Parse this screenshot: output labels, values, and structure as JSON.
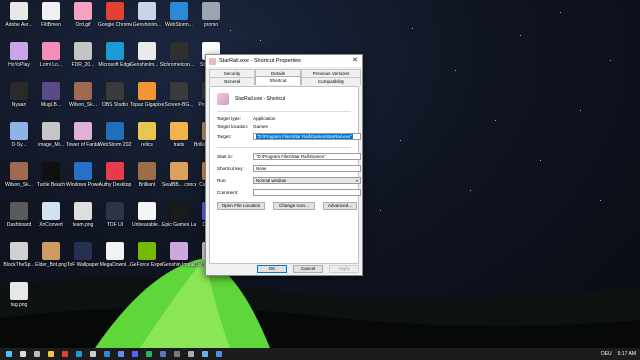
{
  "desktop": {
    "icons": [
      {
        "label": "Adobe Aer...",
        "color": "#e8e8e8"
      },
      {
        "label": "FiltBmen",
        "color": "#f0f0f0"
      },
      {
        "label": "Ord.gif",
        "color": "#f4a2c0"
      },
      {
        "label": "Google Chrome",
        "color": "#e34133"
      },
      {
        "label": "GenshinIm...",
        "color": "#c9d4e6"
      },
      {
        "label": "WebStorm...",
        "color": "#2b89d6"
      },
      {
        "label": "promo",
        "color": "#9da3b0"
      },
      {
        "label": "HoYoPlay",
        "color": "#c8a6e8"
      },
      {
        "label": "Lomi Lo...",
        "color": "#f38fb7"
      },
      {
        "label": "FDR_20...",
        "color": "#c4c4c4"
      },
      {
        "label": "Microsoft Edge",
        "color": "#1a9bd7"
      },
      {
        "label": "GenshinIm... Shortcut",
        "color": "#eaeaea"
      },
      {
        "label": "chromeIcon...",
        "color": "#2f2f2f"
      },
      {
        "label": "StarRail...",
        "color": "#ffffff"
      },
      {
        "label": "Nyaan",
        "color": "#2a2a2a"
      },
      {
        "label": "MugLB...",
        "color": "#5b4a88"
      },
      {
        "label": "Wilson_Sk...",
        "color": "#a06a52"
      },
      {
        "label": "OBS Studio",
        "color": "#3a3a3a"
      },
      {
        "label": "Topaz Gigapixel AI",
        "color": "#f19632"
      },
      {
        "label": "Screen-BG...",
        "color": "#3b3b3b"
      },
      {
        "label": "ProfilePic...",
        "color": "#3c3c3c"
      },
      {
        "label": "D-Sy...",
        "color": "#8fb3e8"
      },
      {
        "label": "image_Mi...",
        "color": "#c6c6c6"
      },
      {
        "label": "Tower of Fantasy",
        "color": "#dfb1d8"
      },
      {
        "label": "WebStorm 2021.1",
        "color": "#1f6fbb"
      },
      {
        "label": "relics",
        "color": "#e9c64f"
      },
      {
        "label": "traits",
        "color": "#f2b34b"
      },
      {
        "label": "Brilliant... concept.png",
        "color": "#c29463"
      },
      {
        "label": "Wilson_Sk...",
        "color": "#a06a52"
      },
      {
        "label": "Turtle Beach",
        "color": "#101010"
      },
      {
        "label": "Windows PowerShell",
        "color": "#2770c5"
      },
      {
        "label": "Authy Desktop",
        "color": "#e83b4c"
      },
      {
        "label": "Brilliant",
        "color": "#9b6e47"
      },
      {
        "label": "SealBB... concept.png",
        "color": "#d9a15b"
      },
      {
        "label": "CarryAvt...",
        "color": "#d98b52"
      },
      {
        "label": "Dashboard",
        "color": "#5a5a5a"
      },
      {
        "label": "XnConvert",
        "color": "#cfe3f0"
      },
      {
        "label": "team.png",
        "color": "#dedede"
      },
      {
        "label": "TOF UI",
        "color": "#2e3346"
      },
      {
        "label": "Unbearable...",
        "color": "#f5f5f5"
      },
      {
        "label": "Epic Games Launcher",
        "color": "#1a1a1a"
      },
      {
        "label": "Discord",
        "color": "#5865f2"
      },
      {
        "label": "BlockTheSp...",
        "color": "#d0d0d0"
      },
      {
        "label": "Elder_Bot.png",
        "color": "#cc9b62"
      },
      {
        "label": "ToF Wallpaper",
        "color": "#253052"
      },
      {
        "label": "MegaDownl...",
        "color": "#f2f2f2"
      },
      {
        "label": "GeForce Experience",
        "color": "#76b900"
      },
      {
        "label": "Genshin Impact",
        "color": "#cda8dc"
      },
      {
        "label": "Discord Cache.bat",
        "color": "#d6d6d6"
      },
      {
        "label": "tag.png",
        "color": "#e7e7e7"
      }
    ]
  },
  "dialog": {
    "title": "StarRail.exe - Shortcut Properties",
    "close_glyph": "✕",
    "tabs_row1": [
      "Security",
      "Details",
      "Previous Versions"
    ],
    "tabs_row2": [
      "General",
      "Shortcut",
      "Compatibility"
    ],
    "active_tab": "Shortcut",
    "shortcut_name": "StarRail.exe - Shortcut",
    "target_type_label": "Target type:",
    "target_type_value": "Application",
    "target_location_label": "Target location:",
    "target_location_value": "Games",
    "target_label": "Target:",
    "target_value": "\"D:\\Program Files\\Star Rail\\Games\\StarRail.exe\"",
    "start_in_label": "Start in:",
    "start_in_value": "\"D:\\Program Files\\Star Rail\\Games\"",
    "shortcut_key_label": "Shortcut key:",
    "shortcut_key_value": "None",
    "run_label": "Run:",
    "run_value": "Normal window",
    "comment_label": "Comment:",
    "comment_value": "",
    "open_file_location": "Open File Location",
    "change_icon": "Change Icon...",
    "advanced": "Advanced...",
    "ok": "OK",
    "cancel": "Cancel",
    "apply": "Apply"
  },
  "taskbar": {
    "icons": [
      "windows-start-icon",
      "search-icon",
      "task-view-icon",
      "file-explorer-icon",
      "chrome-icon",
      "edge-icon",
      "terminal-icon",
      "vscode-icon",
      "store-icon",
      "discord-icon",
      "spotify-icon",
      "steam-icon",
      "obs-icon",
      "settings-icon",
      "photos-icon",
      "mail-icon"
    ],
    "language": "DEU",
    "time": "5:17 AM"
  },
  "colors": {
    "selection": "#0078d7",
    "taskbar": "#1c1c1c",
    "tent_glow": "#6fe63c"
  }
}
